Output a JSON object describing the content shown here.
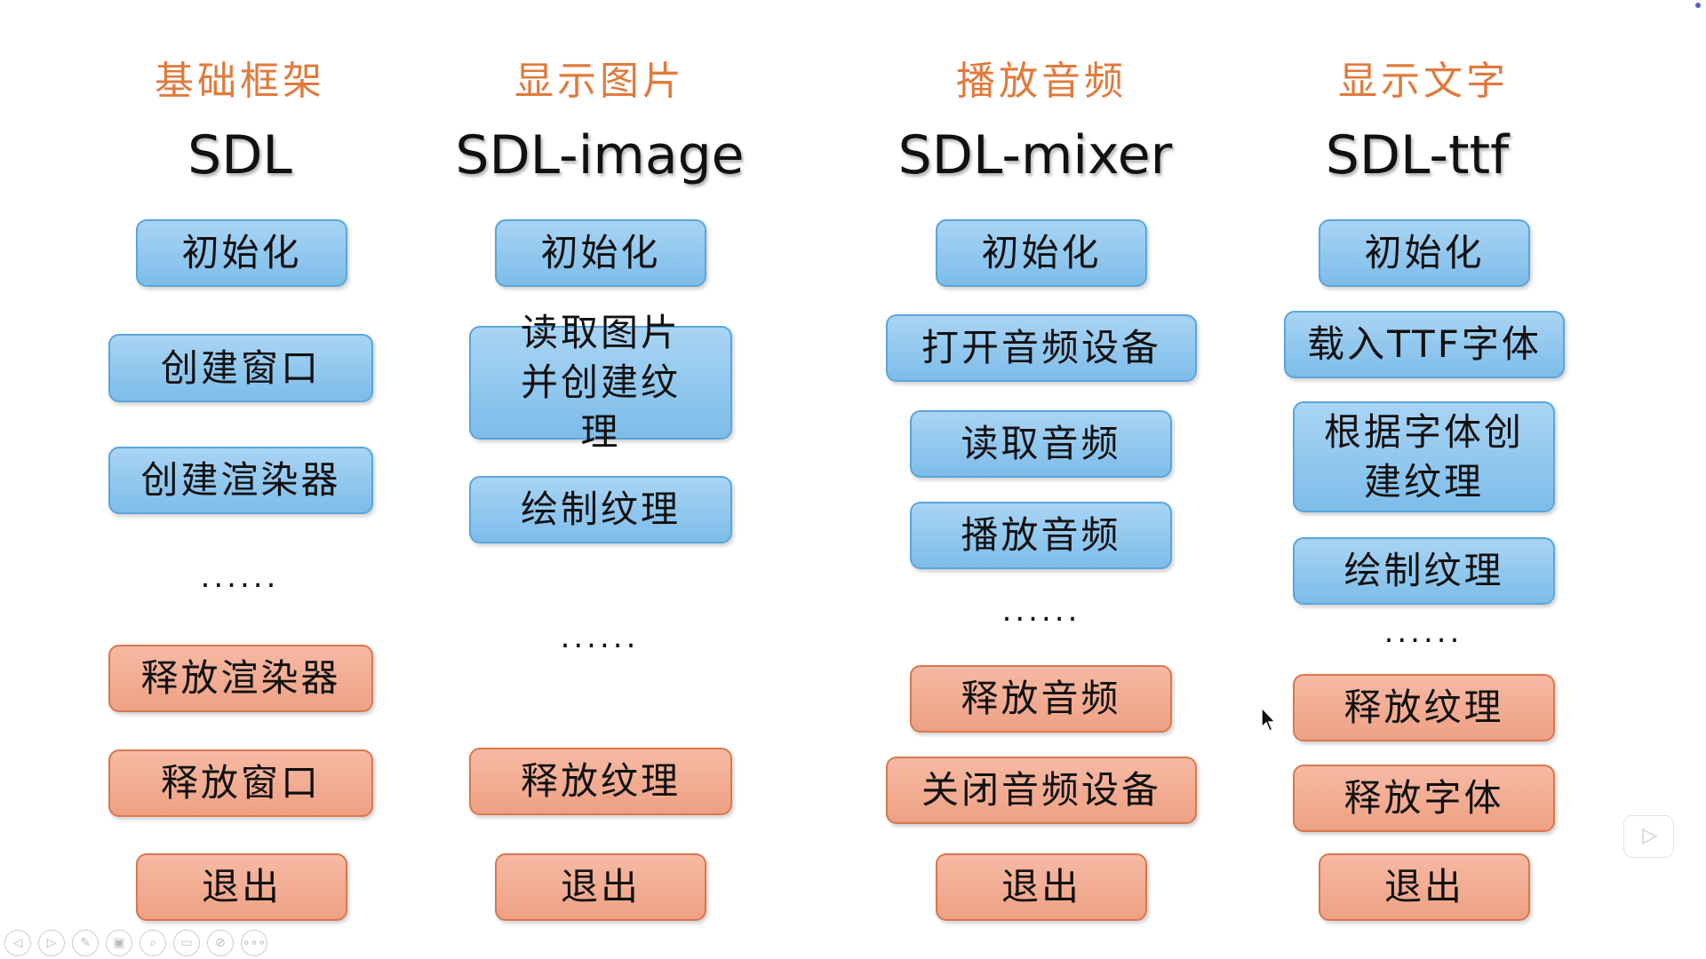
{
  "columns": [
    {
      "category": "基础框架",
      "library": "SDL",
      "steps": [
        "初始化",
        "创建窗口",
        "创建渲染器",
        "释放渲染器",
        "释放窗口",
        "退出"
      ],
      "dots": "......"
    },
    {
      "category": "显示图片",
      "library": "SDL-image",
      "steps": [
        "初始化",
        "读取图片并创建纹理",
        "绘制纹理",
        "释放纹理",
        "退出"
      ],
      "dots": "......"
    },
    {
      "category": "播放音频",
      "library": "SDL-mixer",
      "steps": [
        "初始化",
        "打开音频设备",
        "读取音频",
        "播放音频",
        "释放音频",
        "关闭音频设备",
        "退出"
      ],
      "dots": "......"
    },
    {
      "category": "显示文字",
      "library": "SDL-ttf",
      "steps": [
        "初始化",
        "载入TTF字体",
        "根据字体创建纹理",
        "绘制纹理",
        "释放纹理",
        "释放字体",
        "退出"
      ],
      "dots": "......"
    }
  ],
  "colors": {
    "category": "#e07a3c",
    "init_step": "#7dbde9",
    "cleanup_step": "#eea184"
  },
  "toolbar": [
    "previous-icon",
    "next-icon",
    "pen-icon",
    "slides-icon",
    "zoom-icon",
    "subtitles-icon",
    "camera-off-icon",
    "more-icon"
  ]
}
